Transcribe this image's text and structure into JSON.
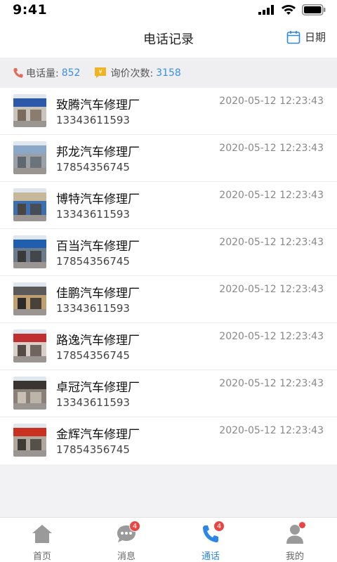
{
  "status": {
    "time": "9:41"
  },
  "header": {
    "title": "电话记录",
    "date_label": "日期"
  },
  "stats": {
    "calls_label": "电话量:",
    "calls_value": "852",
    "inquiries_label": "询价次数:",
    "inquiries_value": "3158"
  },
  "records": [
    {
      "name": "致腾汽车修理厂",
      "phone": "13343611593",
      "time": "2020-05-12 12:23:43",
      "sign_text": "奥车保",
      "palette": [
        "#2d5aa8",
        "#c9c4bc",
        "#7a6c5c"
      ]
    },
    {
      "name": "邦龙汽车修理厂",
      "phone": "17854356745",
      "time": "2020-05-12 12:23:43",
      "sign_text": "",
      "palette": [
        "#8aa8c8",
        "#9aa0a5",
        "#5f6870"
      ]
    },
    {
      "name": "博特汽车修理厂",
      "phone": "13343611593",
      "time": "2020-05-12 12:23:43",
      "sign_text": "",
      "palette": [
        "#c8b89a",
        "#3b6fb0",
        "#4a4540"
      ]
    },
    {
      "name": "百当汽车修理厂",
      "phone": "17854356745",
      "time": "2020-05-12 12:23:43",
      "sign_text": "",
      "palette": [
        "#1f5fae",
        "#6b7b8c",
        "#3a3a3a"
      ]
    },
    {
      "name": "佳鹏汽车修理厂",
      "phone": "13343611593",
      "time": "2020-05-12 12:23:43",
      "sign_text": "",
      "palette": [
        "#5a5a5a",
        "#c0a070",
        "#2b2b2b"
      ]
    },
    {
      "name": "路逸汽车修理厂",
      "phone": "17854356745",
      "time": "2020-05-12 12:23:43",
      "sign_text": "",
      "palette": [
        "#c03030",
        "#d8d0c8",
        "#554a44"
      ]
    },
    {
      "name": "卓冠汽车修理厂",
      "phone": "13343611593",
      "time": "2020-05-12 12:23:43",
      "sign_text": "",
      "palette": [
        "#3a3530",
        "#8a8078",
        "#c8c0b4"
      ]
    },
    {
      "name": "金辉汽车修理厂",
      "phone": "17854356745",
      "time": "2020-05-12 12:23:43",
      "sign_text": "",
      "palette": [
        "#c83020",
        "#b0a89c",
        "#3e3a36"
      ]
    }
  ],
  "tabs": [
    {
      "label": "首页",
      "icon": "home-icon",
      "badge": ""
    },
    {
      "label": "消息",
      "icon": "message-icon",
      "badge": "4"
    },
    {
      "label": "通话",
      "icon": "phone-icon",
      "badge": "4",
      "active": true
    },
    {
      "label": "我的",
      "icon": "profile-icon",
      "badge": ""
    }
  ],
  "colors": {
    "accent": "#2b86e6",
    "badge": "#e94545",
    "stat_value": "#3b8ee8"
  }
}
